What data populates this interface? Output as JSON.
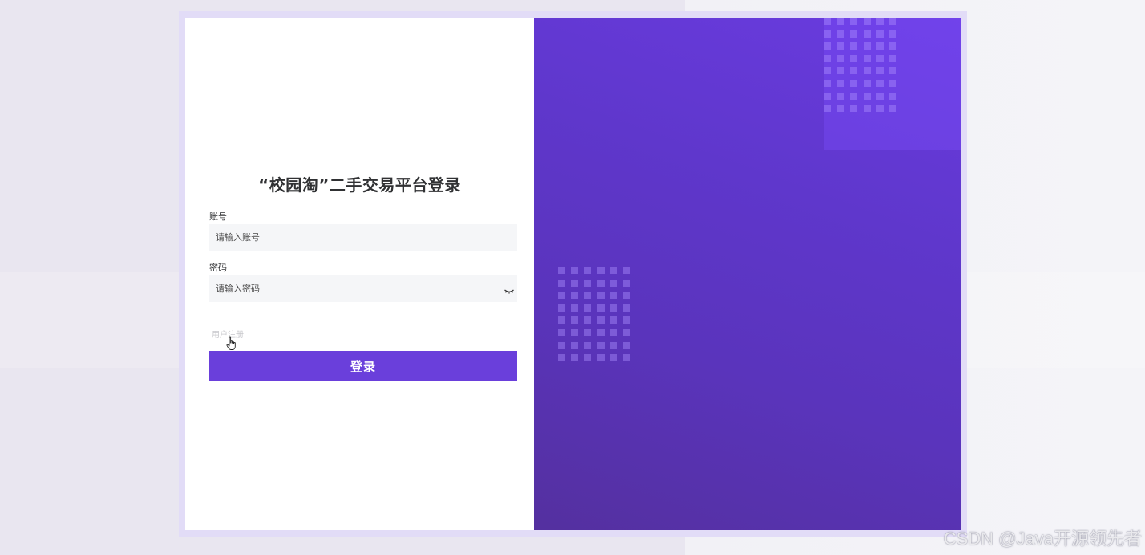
{
  "login": {
    "title": "“校园淘”二手交易平台登录",
    "account_label": "账号",
    "account_placeholder": "请输入账号",
    "account_value": "",
    "password_label": "密码",
    "password_placeholder": "请输入密码",
    "password_value": "",
    "register_link": "用户注册",
    "submit_label": "登录"
  },
  "watermark": "CSDN @Java开源领先者",
  "colors": {
    "accent": "#6a3fdb",
    "panel_gradient_start": "#6a3be0",
    "panel_gradient_end": "#54309f",
    "input_background": "#f5f6f8"
  },
  "icons": {
    "password_toggle": "eye-closed-icon",
    "pointer": "hand-cursor-icon"
  }
}
